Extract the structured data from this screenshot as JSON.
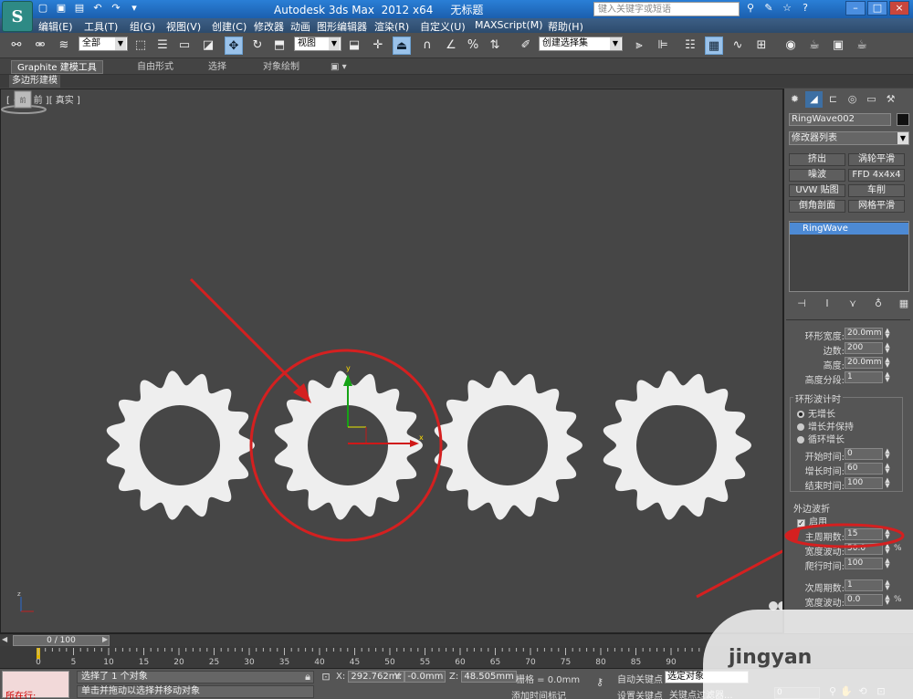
{
  "title_bar": {
    "logo_letter": "S",
    "title": "Autodesk 3ds Max  2012 x64     无标题",
    "search_placeholder": "键入关键字或短语",
    "window_buttons": [
      "–",
      "□",
      "×"
    ]
  },
  "menu": [
    "编辑(E)",
    "工具(T)",
    "组(G)",
    "视图(V)",
    "创建(C)",
    "修改器",
    "动画",
    "图形编辑器",
    "渲染(R)",
    "自定义(U)",
    "MAXScript(M)",
    "帮助(H)"
  ],
  "toolbar": {
    "selection_filter": "全部",
    "ref_coord": "视图",
    "named_selection": "创建选择集"
  },
  "ribbon": {
    "tabs": [
      "Graphite 建模工具",
      "自由形式",
      "选择",
      "对象绘制"
    ],
    "sub": "多边形建模"
  },
  "viewport": {
    "label": "[ + ][ 前 ][ 真实 ]",
    "viewcube_label": "前"
  },
  "command_panel": {
    "object_name": "RingWave002",
    "modifier_list": "修改器列表",
    "modifier_buttons": [
      "挤出",
      "涡轮平滑",
      "噪波",
      "FFD 4x4x4",
      "UVW 贴图",
      "车削",
      "倒角剖面",
      "网格平滑"
    ],
    "stack_item": "RingWave",
    "params": {
      "ring_width": {
        "label": "环形宽度:",
        "value": "20.0mm"
      },
      "sides": {
        "label": "边数:",
        "value": "200"
      },
      "height": {
        "label": "高度:",
        "value": "20.0mm"
      },
      "height_segs": {
        "label": "高度分段:",
        "value": "1"
      }
    },
    "timing": {
      "group": "环形波计时",
      "options": [
        "无增长",
        "增长并保持",
        "循环增长"
      ],
      "start": {
        "label": "开始时间:",
        "value": "0"
      },
      "grow": {
        "label": "增长时间:",
        "value": "60"
      },
      "end": {
        "label": "结束时间:",
        "value": "100"
      }
    },
    "outer_edge": {
      "group": "外边波折",
      "enable": "启用",
      "major_cycles": {
        "label": "主周期数:",
        "value": "15"
      },
      "width_flux": {
        "label": "宽度波动:",
        "value": "50.0",
        "unit": "%"
      },
      "crawl": {
        "label": "爬行时间:",
        "value": "100"
      },
      "minor_cycles": {
        "label": "次周期数:",
        "value": "1"
      },
      "minor_flux": {
        "label": "宽度波动:",
        "value": "0.0",
        "unit": "%"
      }
    }
  },
  "timeline": {
    "slider": "0 / 100",
    "ticks": [
      "0",
      "5",
      "10",
      "15",
      "20",
      "25",
      "30",
      "35",
      "40",
      "45",
      "50",
      "55",
      "60",
      "65",
      "70",
      "75",
      "80",
      "85",
      "90"
    ]
  },
  "status": {
    "maxscript_label": "所在行:",
    "selection": "选择了 1 个对象",
    "prompt": "单击并拖动以选择并移动对象",
    "x": "292.762mr",
    "y": "-0.0mm",
    "z": "48.505mm",
    "grid": "栅格 = 0.0mm",
    "add_time_tag": "添加时间标记",
    "auto_key": "自动关键点",
    "set_key": "设置关键点",
    "sel_set": "选定对象",
    "key_filters": "关键点过滤器...",
    "frame": "0"
  },
  "watermark": "jingyan",
  "colors": {
    "viewport_bg": "#464646",
    "gear_fill": "#eeeeee",
    "annotation_red": "#d42020",
    "selected_blue": "#4d8ad4"
  }
}
